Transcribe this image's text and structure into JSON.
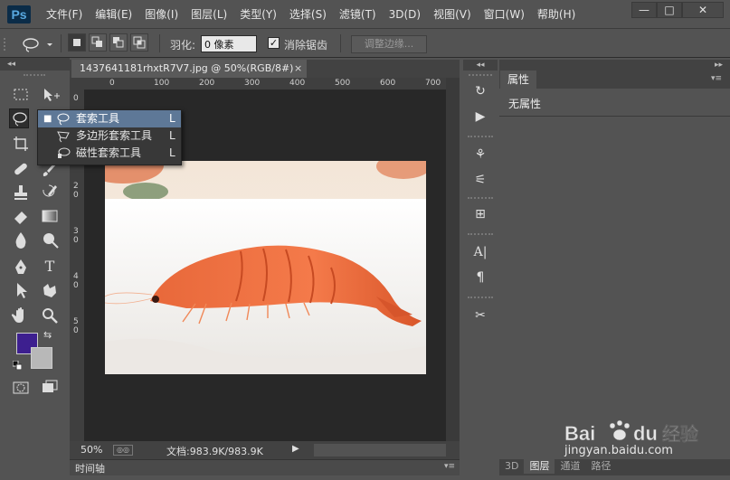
{
  "app": {
    "logo": "Ps"
  },
  "menu": [
    "文件(F)",
    "编辑(E)",
    "图像(I)",
    "图层(L)",
    "类型(Y)",
    "选择(S)",
    "滤镜(T)",
    "3D(D)",
    "视图(V)",
    "窗口(W)",
    "帮助(H)"
  ],
  "window_controls": {
    "minimize": "—",
    "maximize": "□",
    "close": "✕"
  },
  "options": {
    "feather_label": "羽化:",
    "feather_value": "0 像素",
    "antialias_label": "消除锯齿",
    "antialias_checked": true,
    "refine_edge": "调整边缘..."
  },
  "document": {
    "tab_title": "1437641181rhxtR7V7.jpg @ 50%(RGB/8#)",
    "tab_close": "×",
    "ruler_h": [
      "0",
      "100",
      "200",
      "300",
      "400",
      "500",
      "600",
      "700"
    ],
    "ruler_v": [
      "0",
      "1",
      "0",
      "2",
      "0",
      "3",
      "0",
      "4",
      "0",
      "5",
      "0"
    ],
    "zoom": "50%",
    "doc_info": "文档:983.9K/983.9K"
  },
  "timeline": {
    "label": "时间轴"
  },
  "flyout": {
    "items": [
      {
        "name": "套索工具",
        "shortcut": "L",
        "selected": true
      },
      {
        "name": "多边形套索工具",
        "shortcut": "L",
        "selected": false
      },
      {
        "name": "磁性套索工具",
        "shortcut": "L",
        "selected": false
      }
    ]
  },
  "properties": {
    "tab": "属性",
    "content": "无属性"
  },
  "bottom_tabs": [
    "3D",
    "图层",
    "通道",
    "路径"
  ],
  "colors": {
    "foreground": "#3d1f8f",
    "background": "#b8b8b8",
    "flyout_highlight": "#5e7897"
  },
  "watermark": {
    "text": "Bai du 经验",
    "url": "jingyan.baidu.com"
  }
}
